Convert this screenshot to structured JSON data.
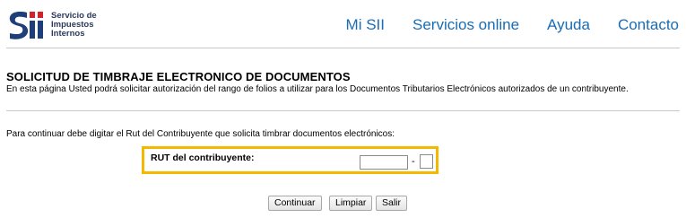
{
  "header": {
    "logo": {
      "mark_text": "Sii",
      "line1": "Servicio de",
      "line2": "Impuestos",
      "line3": "Internos",
      "colors": {
        "mark_blue": "#1f3f7a",
        "mark_red": "#d2232a"
      }
    },
    "nav": [
      {
        "label": "Mi SII"
      },
      {
        "label": "Servicios online"
      },
      {
        "label": "Ayuda"
      },
      {
        "label": "Contacto"
      }
    ],
    "nav_color": "#1a6cb5"
  },
  "main": {
    "title": "SOLICITUD DE TIMBRAJE ELECTRONICO DE DOCUMENTOS",
    "subtitle": "En esta página Usted podrá solicitar autorización del rango de folios a utilizar para los Documentos Tributarios Electrónicos autorizados de un contribuyente.",
    "instruction": "Para continuar debe digitar el Rut del Contribuyente que solicita timbrar documentos electrónicos:",
    "rut": {
      "label": "RUT del contribuyente:",
      "value": "",
      "separator": "-",
      "dv_value": "",
      "highlight_color": "#f5b800"
    },
    "buttons": {
      "continuar": "Continuar",
      "limpiar": "Limpiar",
      "salir": "Salir"
    }
  }
}
